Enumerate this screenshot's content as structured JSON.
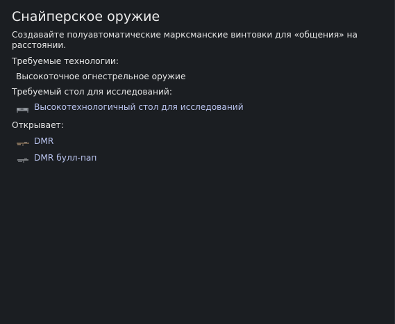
{
  "title": "Снайперское оружие",
  "description": "Создавайте полуавтоматические марксманские винтовки для «общения» на расстоянии.",
  "required_tech": {
    "label": "Требуемые технологии:",
    "items": [
      "Высокоточное огнестрельное оружие"
    ]
  },
  "required_bench": {
    "label": "Требуемый стол для исследований:",
    "item": {
      "name": "Высокотехнологичный стол для исследований",
      "icon": "research-bench-icon"
    }
  },
  "unlocks": {
    "label": "Открывает:",
    "items": [
      {
        "name": "DMR",
        "icon": "rifle-icon"
      },
      {
        "name": "DMR булл-пап",
        "icon": "bullpup-rifle-icon"
      }
    ]
  },
  "colors": {
    "background": "#1b1e22",
    "text": "#e4e4e4",
    "link": "#b9c3ee"
  }
}
